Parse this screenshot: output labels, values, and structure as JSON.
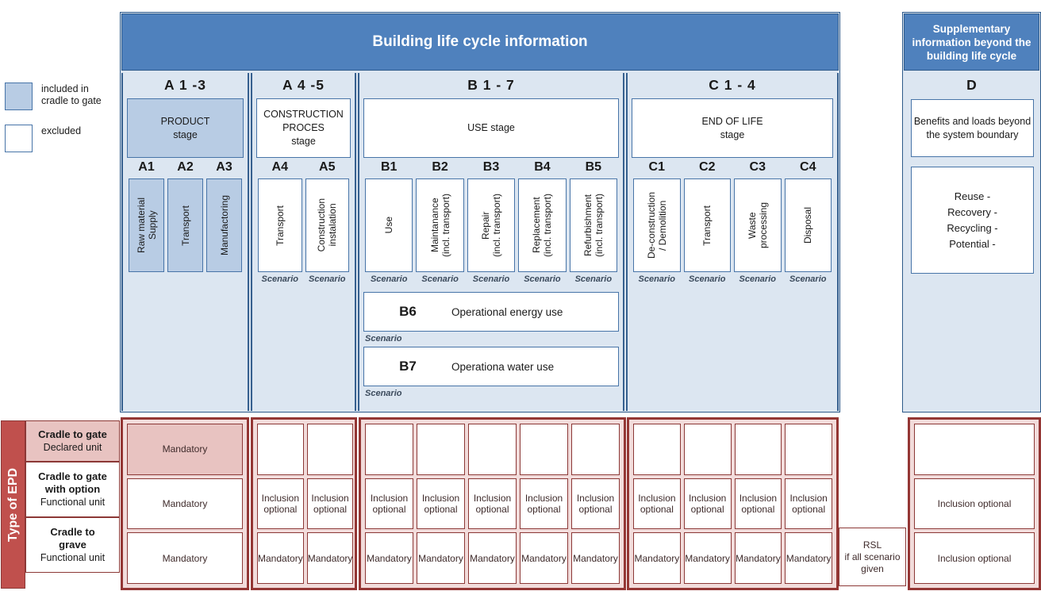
{
  "legend": {
    "items": [
      {
        "swatch": "included",
        "label": "included in\ncradle to gate"
      },
      {
        "swatch": "excluded",
        "label": "excluded"
      }
    ],
    "included_label": "included in cradle to gate",
    "excluded_label": "excluded"
  },
  "colors": {
    "header_blue": "#4f81bd",
    "panel_blue": "#dce6f1",
    "included_blue": "#b8cce4",
    "border_blue": "#4774a8",
    "epd_red": "#c0504d",
    "epd_border_red": "#943634",
    "epd_pink": "#f2dcdb",
    "epd_shaded_pink": "#e8c3c1"
  },
  "main": {
    "header": "Building life cycle information",
    "stages": [
      {
        "code": "A 1 -3",
        "stage_name": "PRODUCT\nstage",
        "stage_included": true,
        "modules": [
          {
            "code": "A1",
            "label": "Raw material\nSupply",
            "included": true,
            "scenario": ""
          },
          {
            "code": "A2",
            "label": "Transport",
            "included": true,
            "scenario": ""
          },
          {
            "code": "A3",
            "label": "Manufactoring",
            "included": true,
            "scenario": ""
          }
        ]
      },
      {
        "code": "A 4 -5",
        "stage_name": "CONSTRUCTION\nPROCES\nstage",
        "stage_included": false,
        "modules": [
          {
            "code": "A4",
            "label": "Transport",
            "included": false,
            "scenario": "Scenario"
          },
          {
            "code": "A5",
            "label": "Construction\ninstalation",
            "included": false,
            "scenario": "Scenario"
          }
        ]
      },
      {
        "code": "B 1 - 7",
        "stage_name": "USE stage",
        "stage_included": false,
        "modules": [
          {
            "code": "B1",
            "label": "Use",
            "included": false,
            "scenario": "Scenario"
          },
          {
            "code": "B2",
            "label": "Maintanance\n(incl. transport)",
            "included": false,
            "scenario": "Scenario"
          },
          {
            "code": "B3",
            "label": "Repair\n(incl. transport)",
            "included": false,
            "scenario": "Scenario"
          },
          {
            "code": "B4",
            "label": "Replacement\n(incl. transport)",
            "included": false,
            "scenario": "Scenario"
          },
          {
            "code": "B5",
            "label": "Refurbishment\n(incl. transport)",
            "included": false,
            "scenario": "Scenario"
          }
        ],
        "wide_modules": [
          {
            "code": "B6",
            "label": "Operational energy use",
            "scenario": "Scenario"
          },
          {
            "code": "B7",
            "label": "Operationa water use",
            "scenario": "Scenario"
          }
        ]
      },
      {
        "code": "C 1 - 4",
        "stage_name": "END OF LIFE\nstage",
        "stage_included": false,
        "modules": [
          {
            "code": "C1",
            "label": "De-construction\n/ Demolition",
            "included": false,
            "scenario": "Scenario"
          },
          {
            "code": "C2",
            "label": "Transport",
            "included": false,
            "scenario": "Scenario"
          },
          {
            "code": "C3",
            "label": "Waste\nprocessing",
            "included": false,
            "scenario": "Scenario"
          },
          {
            "code": "C4",
            "label": "Disposal",
            "included": false,
            "scenario": "Scenario"
          }
        ]
      }
    ]
  },
  "supplementary": {
    "header": "Supplementary information beyond the building life cycle",
    "code": "D",
    "box1": "Benefits and loads beyond the system boundary",
    "box2": "Reuse -\nRecovery -\nRecycling -\nPotential -"
  },
  "epd": {
    "title": "Type of EPD",
    "rows": [
      {
        "main": "Cradle to gate",
        "sub": "Declared unit",
        "shaded": true
      },
      {
        "main": "Cradle to gate\nwith option",
        "sub": "Functional unit",
        "shaded": false
      },
      {
        "main": "Cradle to\ngrave",
        "sub": "Functional unit",
        "shaded": false
      }
    ],
    "groups": [
      {
        "group": "A1-3",
        "columns": [
          {
            "module": "A1-3",
            "cells": [
              "Mandatory",
              "Mandatory",
              "Mandatory"
            ]
          }
        ]
      },
      {
        "group": "A4-5",
        "columns": [
          {
            "module": "A4",
            "cells": [
              "",
              "Inclusion\noptional",
              "Mandatory"
            ]
          },
          {
            "module": "A5",
            "cells": [
              "",
              "Inclusion\noptional",
              "Mandatory"
            ]
          }
        ]
      },
      {
        "group": "B1-5",
        "columns": [
          {
            "module": "B1",
            "cells": [
              "",
              "Inclusion\noptional",
              "Mandatory"
            ]
          },
          {
            "module": "B2",
            "cells": [
              "",
              "Inclusion\noptional",
              "Mandatory"
            ]
          },
          {
            "module": "B3",
            "cells": [
              "",
              "Inclusion\noptional",
              "Mandatory"
            ]
          },
          {
            "module": "B4",
            "cells": [
              "",
              "Inclusion\noptional",
              "Mandatory"
            ]
          },
          {
            "module": "B5",
            "cells": [
              "",
              "Inclusion\noptional",
              "Mandatory"
            ]
          }
        ]
      },
      {
        "group": "C1-4",
        "columns": [
          {
            "module": "C1",
            "cells": [
              "",
              "Inclusion\noptional",
              "Mandatory"
            ]
          },
          {
            "module": "C2",
            "cells": [
              "",
              "Inclusion\noptional",
              "Mandatory"
            ]
          },
          {
            "module": "C3",
            "cells": [
              "",
              "Inclusion\noptional",
              "Mandatory"
            ]
          },
          {
            "module": "C4",
            "cells": [
              "",
              "Inclusion\noptional",
              "Mandatory"
            ]
          }
        ]
      },
      {
        "group": "D",
        "columns": [
          {
            "module": "D",
            "cells": [
              "",
              "Inclusion optional",
              "Inclusion optional"
            ]
          }
        ]
      }
    ],
    "rsl_note": "RSL\nif all scenario\ngiven"
  }
}
